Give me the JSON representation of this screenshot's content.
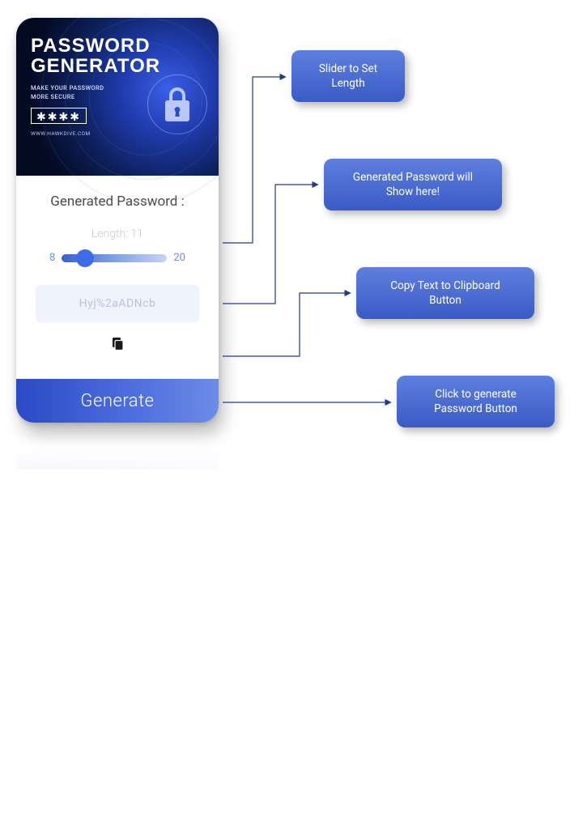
{
  "phone": {
    "header": {
      "title": "PASSWORD\nGENERATOR",
      "subtitle": "MAKE YOUR PASSWORD\nMORE SECURE",
      "url": "WWW.HAWKDIVE.COM"
    },
    "body": {
      "title": "Generated Password :",
      "length_label": "Length: 11",
      "slider_min": "8",
      "slider_max": "20",
      "password_value": "Hyj%2aADNcb"
    },
    "generate_label": "Generate"
  },
  "callouts": {
    "c1": "Slider to Set\nLength",
    "c2": "Generated Password will\nShow here!",
    "c3": "Copy Text to Clipboard\nButton",
    "c4": "Click to generate\nPassword Button"
  }
}
